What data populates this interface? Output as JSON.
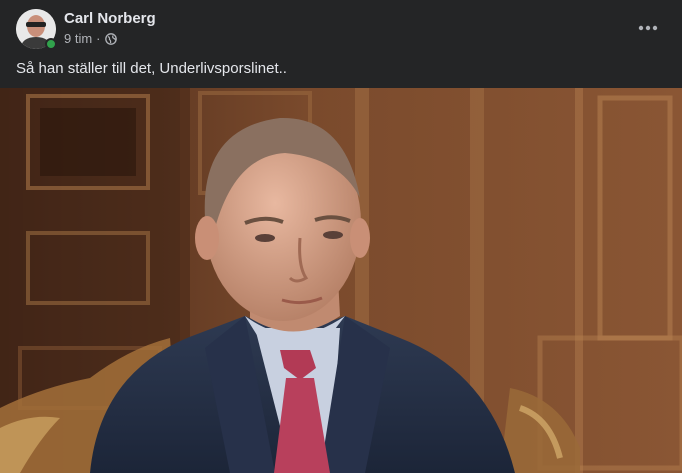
{
  "post": {
    "author": "Carl Norberg",
    "time": "9 tim",
    "separator": "·",
    "audience_icon": "globe-icon",
    "text": "Så han ställer till det, Underlivsporslinet..",
    "more_icon": "more-options-icon"
  },
  "colors": {
    "card_bg": "#242526",
    "text_primary": "#e4e6eb",
    "text_secondary": "#b0b3b8",
    "online": "#31a24c"
  }
}
